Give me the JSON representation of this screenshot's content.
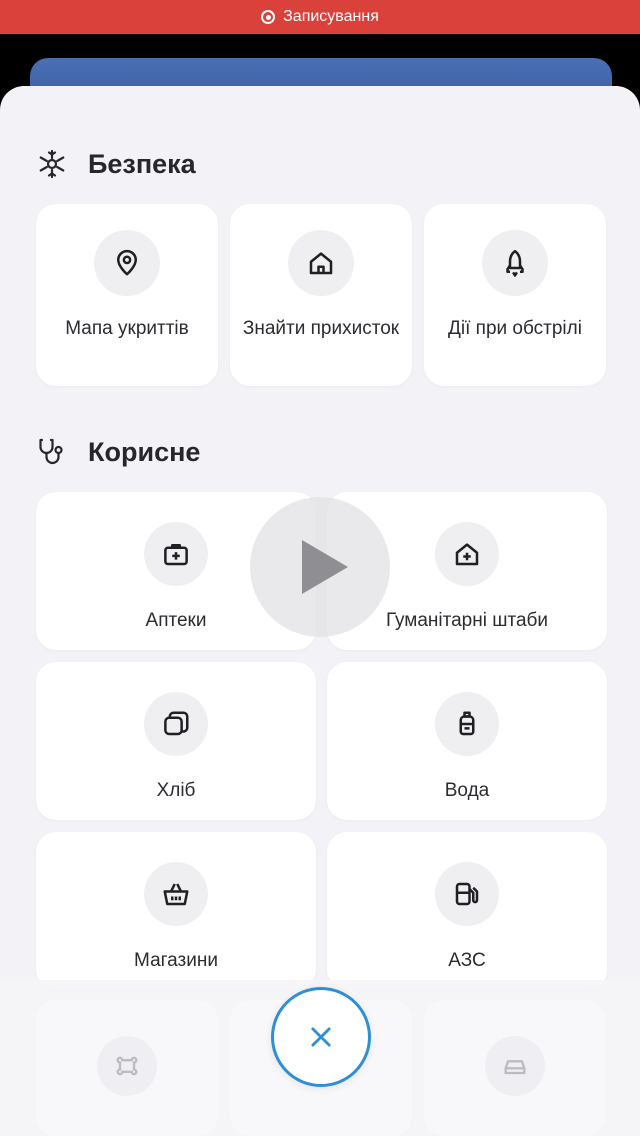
{
  "status_bar": {
    "recording_label": "Записування"
  },
  "sections": {
    "safety": {
      "title": "Безпека",
      "icon": "snowflake-icon",
      "items": [
        {
          "label": "Мапа укриттів",
          "icon": "map-pin-icon"
        },
        {
          "label": "Знайти прихисток",
          "icon": "home-icon"
        },
        {
          "label": "Дії при обстрілі",
          "icon": "rocket-icon"
        }
      ]
    },
    "useful": {
      "title": "Корисне",
      "icon": "stethoscope-icon",
      "items": [
        {
          "label": "Аптеки",
          "icon": "first-aid-kit-icon"
        },
        {
          "label": "Гуманітарні штаби",
          "icon": "home-plus-icon"
        },
        {
          "label": "Хліб",
          "icon": "bread-icon"
        },
        {
          "label": "Вода",
          "icon": "water-bottle-icon"
        },
        {
          "label": "Магазини",
          "icon": "basket-icon"
        },
        {
          "label": "АЗС",
          "icon": "gas-station-icon"
        }
      ]
    }
  },
  "overlay": {
    "play_icon": "play-icon",
    "close_icon": "close-icon"
  },
  "colors": {
    "recording_bar": "#d9413a",
    "accent": "#2f8fd6",
    "sheet_background": "#f3f3f7"
  }
}
